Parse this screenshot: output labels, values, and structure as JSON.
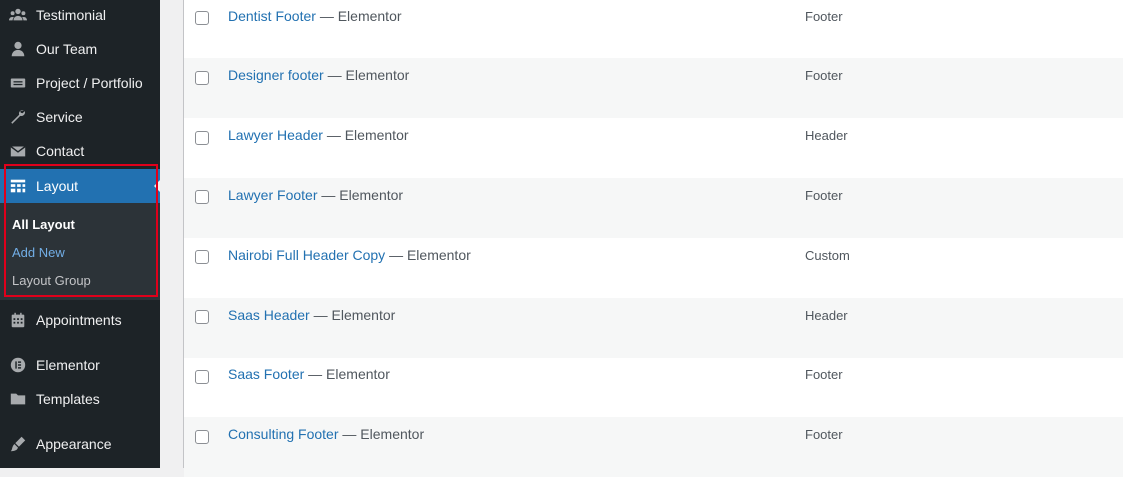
{
  "sidebar": {
    "items": [
      {
        "label": "Testimonial",
        "icon": "groups-icon"
      },
      {
        "label": "Our Team",
        "icon": "user-icon"
      },
      {
        "label": "Project / Portfolio",
        "icon": "portfolio-icon"
      },
      {
        "label": "Service",
        "icon": "wrench-icon"
      },
      {
        "label": "Contact",
        "icon": "envelope-icon"
      },
      {
        "label": "Layout",
        "icon": "layout-grid-icon",
        "current": true
      },
      {
        "label": "Appointments",
        "icon": "calendar-icon"
      },
      {
        "label": "Elementor",
        "icon": "elementor-icon"
      },
      {
        "label": "Templates",
        "icon": "folder-icon"
      },
      {
        "label": "Appearance",
        "icon": "paintbrush-icon"
      }
    ],
    "submenu": [
      {
        "label": "All Layout",
        "state": "active"
      },
      {
        "label": "Add New",
        "state": "hover"
      },
      {
        "label": "Layout Group",
        "state": "normal"
      }
    ]
  },
  "table": {
    "separator": "— Elementor",
    "rows": [
      {
        "title": "Dentist Footer",
        "type": "Footer"
      },
      {
        "title": "Designer footer",
        "type": "Footer"
      },
      {
        "title": "Lawyer Header",
        "type": "Header"
      },
      {
        "title": "Lawyer Footer",
        "type": "Footer"
      },
      {
        "title": "Nairobi Full Header Copy",
        "type": "Custom"
      },
      {
        "title": "Saas Header",
        "type": "Header"
      },
      {
        "title": "Saas Footer",
        "type": "Footer"
      },
      {
        "title": "Consulting Footer",
        "type": "Footer"
      }
    ]
  },
  "colors": {
    "sidebar_bg": "#1d2327",
    "accent": "#2271b1",
    "highlight": "#e0001b"
  }
}
